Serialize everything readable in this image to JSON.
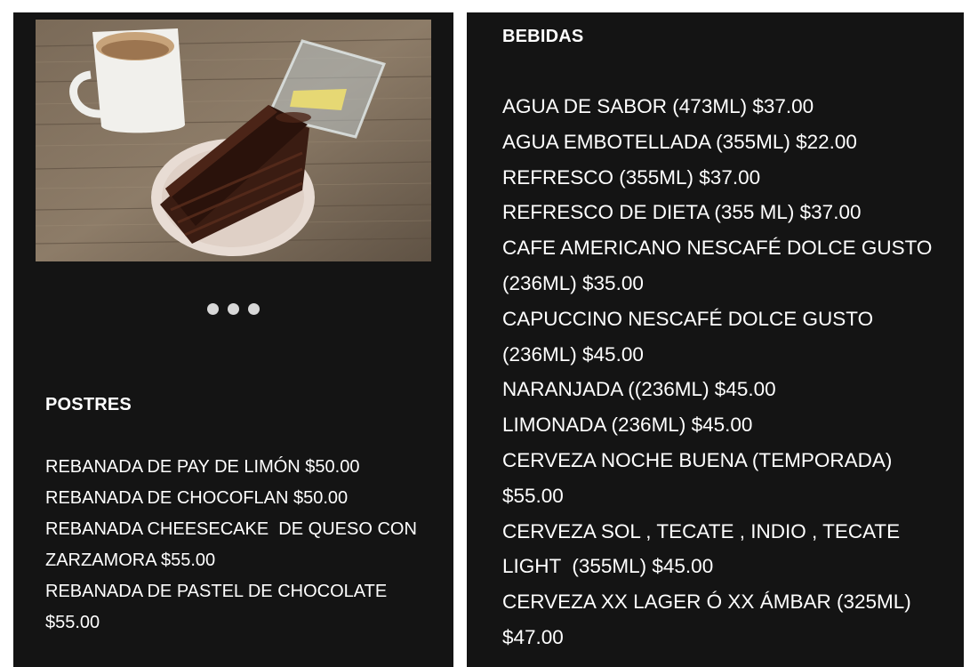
{
  "carousel": {
    "dots": 3
  },
  "postres": {
    "title": "POSTRES",
    "items": [
      "REBANADA DE PAY DE LIMÓN $50.00",
      "REBANADA DE CHOCOFLAN $50.00",
      "REBANADA CHEESECAKE  DE QUESO CON ZARZAMORA $55.00",
      "REBANADA DE PASTEL DE CHOCOLATE $55.00"
    ]
  },
  "bebidas": {
    "title": "BEBIDAS",
    "items": [
      "AGUA DE SABOR (473ML) $37.00",
      "AGUA EMBOTELLADA (355ML) $22.00",
      "REFRESCO (355ML) $37.00",
      "REFRESCO DE DIETA (355 ML) $37.00",
      "CAFE AMERICANO NESCAFÉ DOLCE GUSTO (236ML) $35.00",
      "CAPUCCINO NESCAFÉ DOLCE GUSTO (236ML) $45.00",
      "NARANJADA ((236ML) $45.00",
      "LIMONADA (236ML) $45.00",
      "CERVEZA NOCHE BUENA (TEMPORADA) $55.00",
      "CERVEZA SOL , TECATE , INDIO , TECATE LIGHT  (355ML) $45.00",
      "CERVEZA XX LAGER Ó XX ÁMBAR (325ML) $47.00"
    ]
  },
  "colors": {
    "panel_background": "#141414",
    "text": "#ffffff",
    "dot": "#d8d8d8"
  }
}
